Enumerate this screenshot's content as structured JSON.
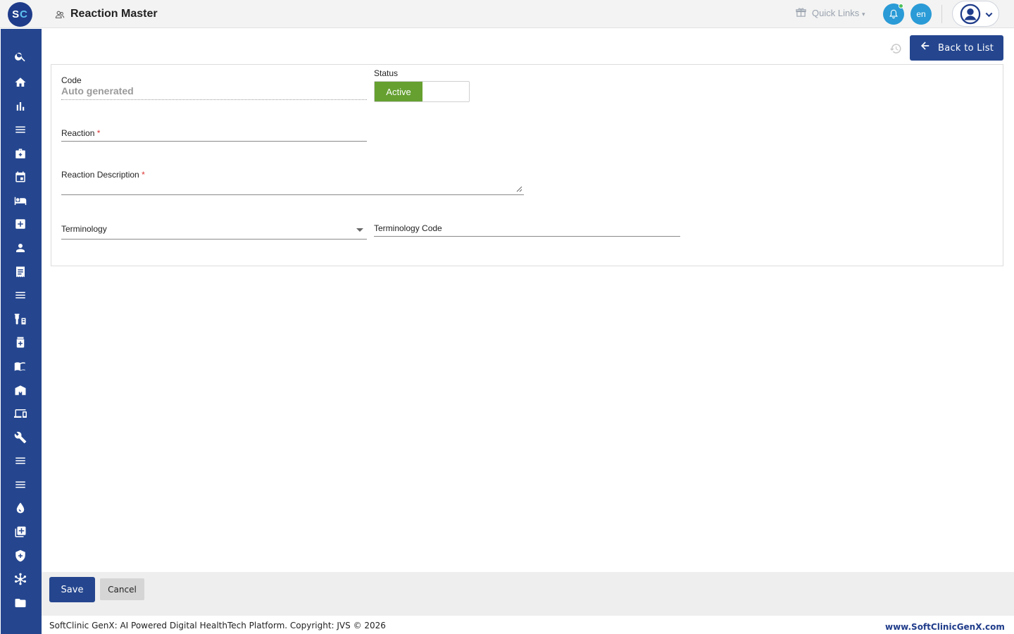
{
  "header": {
    "logo_left": "S",
    "logo_right": "C",
    "page_title": "Reaction Master",
    "quick_links_label": "Quick Links",
    "language": "en"
  },
  "sidebar": {
    "items": [
      {
        "icon": "search-icon"
      },
      {
        "icon": "home-icon"
      },
      {
        "icon": "bar-chart-icon"
      },
      {
        "icon": "menu-icon"
      },
      {
        "icon": "medical-bag-icon"
      },
      {
        "icon": "calendar-icon"
      },
      {
        "icon": "bed-icon"
      },
      {
        "icon": "medical-plus-icon"
      },
      {
        "icon": "person-icon"
      },
      {
        "icon": "receipt-icon"
      },
      {
        "icon": "menu-icon"
      },
      {
        "icon": "lab-icon"
      },
      {
        "icon": "pharmacy-icon"
      },
      {
        "icon": "book-icon"
      },
      {
        "icon": "store-icon"
      },
      {
        "icon": "devices-icon"
      },
      {
        "icon": "wrench-icon"
      },
      {
        "icon": "menu-icon"
      },
      {
        "icon": "menu-icon"
      },
      {
        "icon": "blood-drop-icon"
      },
      {
        "icon": "add-box-icon"
      },
      {
        "icon": "shield-plus-icon"
      },
      {
        "icon": "network-icon"
      },
      {
        "icon": "folder-icon"
      }
    ]
  },
  "toolbar": {
    "back_label": "Back to List"
  },
  "form": {
    "code_label": "Code",
    "code_value": "Auto generated",
    "status_label": "Status",
    "status_value": "Active",
    "reaction_label": "Reaction",
    "reaction_description_label": "Reaction Description",
    "required_mark": "*",
    "terminology_label": "Terminology",
    "terminology_code_label": "Terminology Code"
  },
  "actions": {
    "save_label": "Save",
    "cancel_label": "Cancel"
  },
  "footer": {
    "copyright": "SoftClinic GenX: AI Powered Digital HealthTech Platform. Copyright: JVS © 2026",
    "website": "www.SoftClinicGenX.com"
  },
  "colors": {
    "primary": "#25468f",
    "accent": "#2a9bd6",
    "status_active": "#65a030"
  }
}
